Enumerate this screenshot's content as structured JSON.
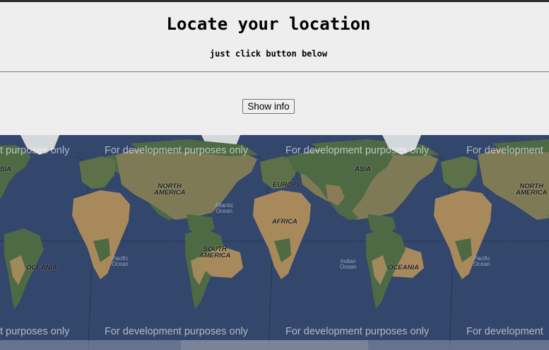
{
  "page": {
    "title": "Locate your location",
    "subtitle": "just click button below",
    "button_label": "Show info"
  },
  "map": {
    "watermark_text": "For development purposes only",
    "watermark_left_partial": "t purposes only",
    "watermark_right_partial": "For development",
    "continents": {
      "north_america": "NORTH\nAMERICA",
      "south_america": "SOUTH\nAMERICA",
      "europe": "EUROPE",
      "africa": "AFRICA",
      "asia": "ASIA",
      "asia_partial": "SIA",
      "oceania": "OCEANIA"
    },
    "oceans": {
      "atlantic": "Atlantic\nOcean",
      "pacific": "Pacific\nOcean",
      "indian": "Indian\nOcean"
    }
  }
}
